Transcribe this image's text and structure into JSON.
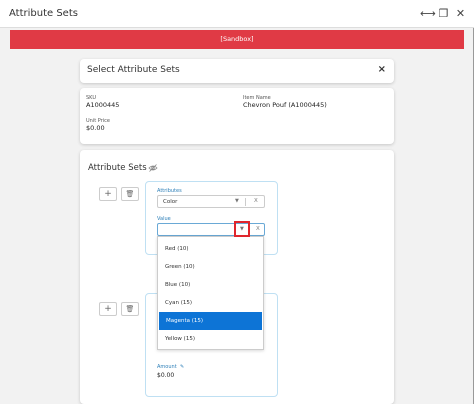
{
  "window": {
    "title": "Attribute Sets"
  },
  "banner": {
    "text": "[Sandbox]"
  },
  "modal": {
    "title": "Select Attribute Sets",
    "close_label": "×"
  },
  "item_info": {
    "sku_label": "SKU",
    "sku_value": "A1000445",
    "item_name_label": "Item Name",
    "item_name_value": "Chevron Pouf (A1000445)",
    "unit_price_label": "Unit Price",
    "unit_price_value": "$0.00"
  },
  "attribute_sets": {
    "title": "Attribute Sets",
    "add_label": "+",
    "delete_label": "🗑",
    "set1": {
      "attributes_label": "Attributes",
      "attributes_value": "Color",
      "value_label": "Value",
      "value_current": "",
      "clear_label": "X",
      "arrow_label": "▼"
    },
    "set2": {
      "amount_label": "Amount",
      "amount_value": "$0.00"
    }
  },
  "dropdown": {
    "options": [
      "Red (10)",
      "Green (10)",
      "Blue (10)",
      "Cyan (15)",
      "Magenta (15)",
      "Yellow (15)"
    ],
    "selected_index": 4
  },
  "colors": {
    "banner": "#e03a45",
    "selected": "#0d74d6",
    "highlight": "#e0262d",
    "accent": "#2d7fb8"
  }
}
